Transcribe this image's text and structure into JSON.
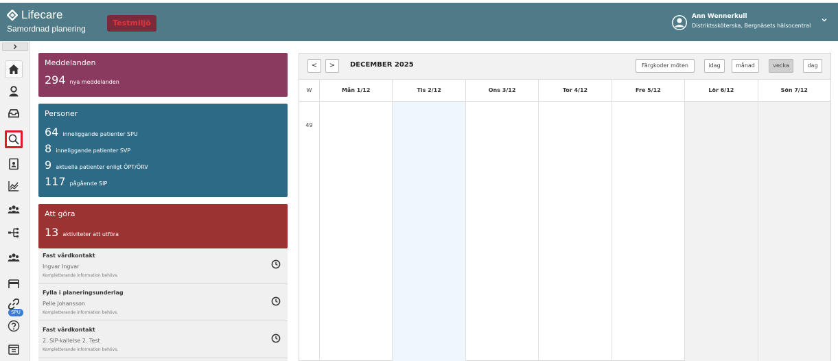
{
  "app": {
    "name": "Lifecare",
    "subtitle": "Samordnad planering",
    "environment": "Testmiljö",
    "colors": {
      "header": "#4e7b87",
      "messages": "#8a3a5e",
      "persons": "#2c6a85",
      "todo": "#9b3333"
    }
  },
  "user": {
    "name": "Ann Wennerkull",
    "role": "Distriktssköterska, Bergnäsets hälsocentral"
  },
  "sidebar": {
    "items": [
      {
        "icon": "home-icon"
      },
      {
        "icon": "user-icon"
      },
      {
        "icon": "inbox-icon"
      },
      {
        "icon": "search-icon"
      },
      {
        "icon": "report-icon"
      },
      {
        "icon": "chart-icon"
      },
      {
        "icon": "group-icon"
      },
      {
        "icon": "hierarchy-icon"
      },
      {
        "icon": "group-spu-icon"
      },
      {
        "icon": "bed-icon"
      },
      {
        "icon": "link-icon"
      },
      {
        "icon": "help-icon"
      },
      {
        "icon": "calendar-icon"
      }
    ],
    "spu_badge": "SPU"
  },
  "messages": {
    "title": "Meddelanden",
    "count": "294",
    "label": "nya meddelanden"
  },
  "persons": {
    "title": "Personer",
    "stats": [
      {
        "count": "64",
        "label": "inneliggande patienter SPU"
      },
      {
        "count": "8",
        "label": "inneliggande patienter SVP"
      },
      {
        "count": "9",
        "label": "aktuella patienter enligt ÖPT/ÖRV"
      },
      {
        "count": "117",
        "label": "pågående SIP"
      }
    ]
  },
  "todo": {
    "title": "Att göra",
    "count": "13",
    "label": "aktiviteter att utföra",
    "items": [
      {
        "title": "Fast vårdkontakt",
        "person": "Ingvar Ingvar",
        "note": "Kompletterande information behövs."
      },
      {
        "title": "Fylla i planeringsunderlag",
        "person": "Pelle Johansson",
        "note": "Kompletterande information behövs."
      },
      {
        "title": "Fast vårdkontakt",
        "person": "2. SIP-kallelse 2. Test",
        "note": "Kompletterande information behövs."
      }
    ]
  },
  "calendar": {
    "month": "DECEMBER 2025",
    "prev": "<",
    "next": ">",
    "buttons": {
      "color_codes": "Färgkoder möten",
      "today": "idag",
      "month": "månad",
      "week": "vecka",
      "day": "dag"
    },
    "active_view": "vecka",
    "week_label": "W",
    "week_number": "49",
    "days": [
      "Mån 1/12",
      "Tis 2/12",
      "Ons 3/12",
      "Tor 4/12",
      "Fre 5/12",
      "Lör 6/12",
      "Sön 7/12"
    ],
    "today_col": 1,
    "weekend_cols": [
      5,
      6
    ],
    "colors": {
      "today": "#f0f7fc",
      "weekend": "#f2f2f2"
    }
  }
}
